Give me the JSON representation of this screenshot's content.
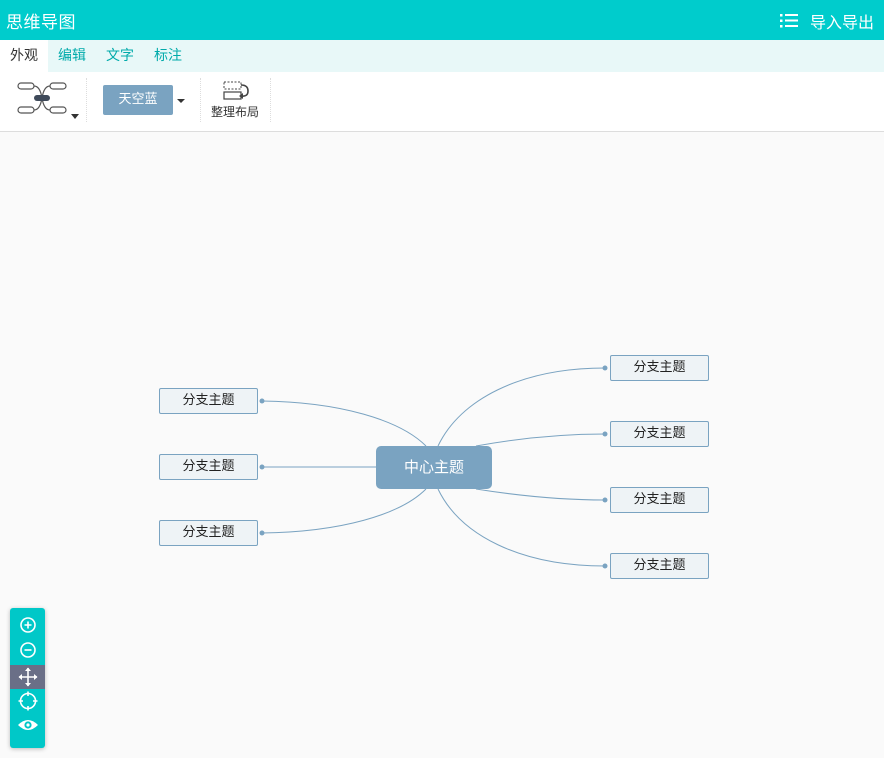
{
  "app": {
    "title": "思维导图",
    "export_label": "导入导出"
  },
  "tabs": [
    {
      "label": "外观",
      "active": true
    },
    {
      "label": "编辑",
      "active": false
    },
    {
      "label": "文字",
      "active": false
    },
    {
      "label": "标注",
      "active": false
    }
  ],
  "toolbar": {
    "theme_label": "天空蓝",
    "layout_label": "整理布局"
  },
  "mindmap": {
    "root": "中心主题",
    "left_branches": [
      "分支主题",
      "分支主题",
      "分支主题"
    ],
    "right_branches": [
      "分支主题",
      "分支主题",
      "分支主题",
      "分支主题"
    ]
  },
  "colors": {
    "header": "#00cccc",
    "tabbar": "#e8f8f8",
    "theme": "#7aa3c1",
    "zoom_active": "#6a6f87"
  },
  "zoom_controls": [
    "zoom-in-icon",
    "zoom-out-icon",
    "move-icon",
    "locate-icon",
    "eye-icon"
  ]
}
